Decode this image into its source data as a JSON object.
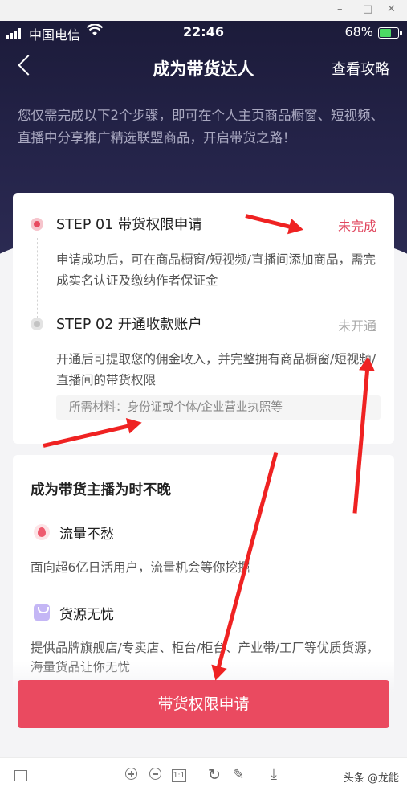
{
  "window": {
    "minimize": "–",
    "maximize": "□",
    "close": "✕"
  },
  "statusbar": {
    "carrier": "中国电信",
    "time": "22:46",
    "battery": "68%"
  },
  "navbar": {
    "title": "成为带货达人",
    "guide": "查看攻略"
  },
  "intro": "您仅需完成以下2个步骤，即可在个人主页商品橱窗、短视频、直播中分享推广精选联盟商品，开启带货之路！",
  "steps": [
    {
      "title": "STEP 01 带货权限申请",
      "status": "未完成",
      "desc": "申请成功后，可在商品橱窗/短视频/直播间添加商品，需完成实名认证及缴纳作者保证金"
    },
    {
      "title": "STEP 02 开通收款账户",
      "status": "未开通",
      "desc": "开通后可提取您的佣金收入，并完整拥有商品橱窗/短视频/直播间的带货权限",
      "materials": "所需材料：身份证或个体/企业营业执照等"
    }
  ],
  "benefits": {
    "title": "成为带货主播为时不晚",
    "items": [
      {
        "icon": "flame-icon",
        "title": "流量不愁",
        "desc": "面向超6亿日活用户，流量机会等你挖掘"
      },
      {
        "icon": "bag-icon",
        "title": "货源无忧",
        "desc": "提供品牌旗舰店/专卖店、柜台/柜台、产业带/工厂等优质货源，海量货品让你无忧"
      }
    ]
  },
  "apply_button": "带货权限申请",
  "toolbar": {
    "actual_size": "1:1",
    "rotate": "↻",
    "edit": "✎",
    "download": "⤓",
    "watermark": "头条 @龙能"
  },
  "colors": {
    "accent": "#ea4a60",
    "hero": "#1c1b3a",
    "status_red": "#e0465e",
    "annotation": "#ef2222"
  }
}
